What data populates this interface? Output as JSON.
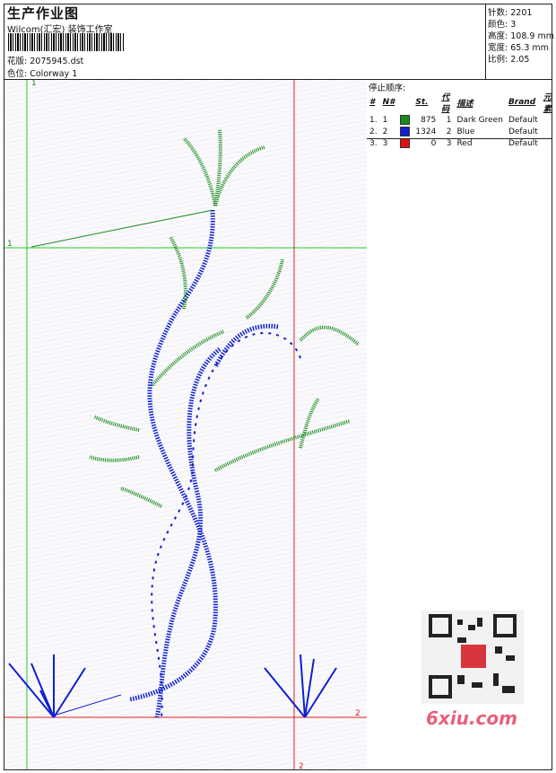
{
  "header": {
    "title": "生产作业图",
    "subtitle": "Wilcom(汇宏) 装饰工作室",
    "design_file_label": "花版:",
    "design_file": "2075945.dst",
    "colorway_label": "色位:",
    "colorway": "Colorway 1"
  },
  "info": {
    "stitches_label": "针数:",
    "stitches": "2201",
    "colors_label": "颜色:",
    "colors": "3",
    "height_label": "高度:",
    "height": "108.9 mm",
    "width_label": "宽度:",
    "width": "65.3 mm",
    "scale_label": "比例:",
    "scale": "2.05"
  },
  "stop_sequence": {
    "title": "停止顺序:",
    "columns": [
      "#",
      "N#",
      "St.",
      "代码",
      "描述",
      "Brand",
      "元素"
    ],
    "rows": [
      {
        "idx": "1.",
        "n": "1",
        "color": "#1a8a1a",
        "st": "875",
        "code": "1",
        "desc": "Dark Green",
        "brand": "Default"
      },
      {
        "idx": "2.",
        "n": "2",
        "color": "#1020d0",
        "st": "1324",
        "code": "2",
        "desc": "Blue",
        "brand": "Default"
      },
      {
        "idx": "3.",
        "n": "3",
        "color": "#e01010",
        "st": "0",
        "code": "3",
        "desc": "Red",
        "brand": "Default"
      }
    ]
  },
  "guides": {
    "mark_1": "1",
    "mark_2": "2"
  },
  "watermark": {
    "site": "6xiu.com"
  }
}
